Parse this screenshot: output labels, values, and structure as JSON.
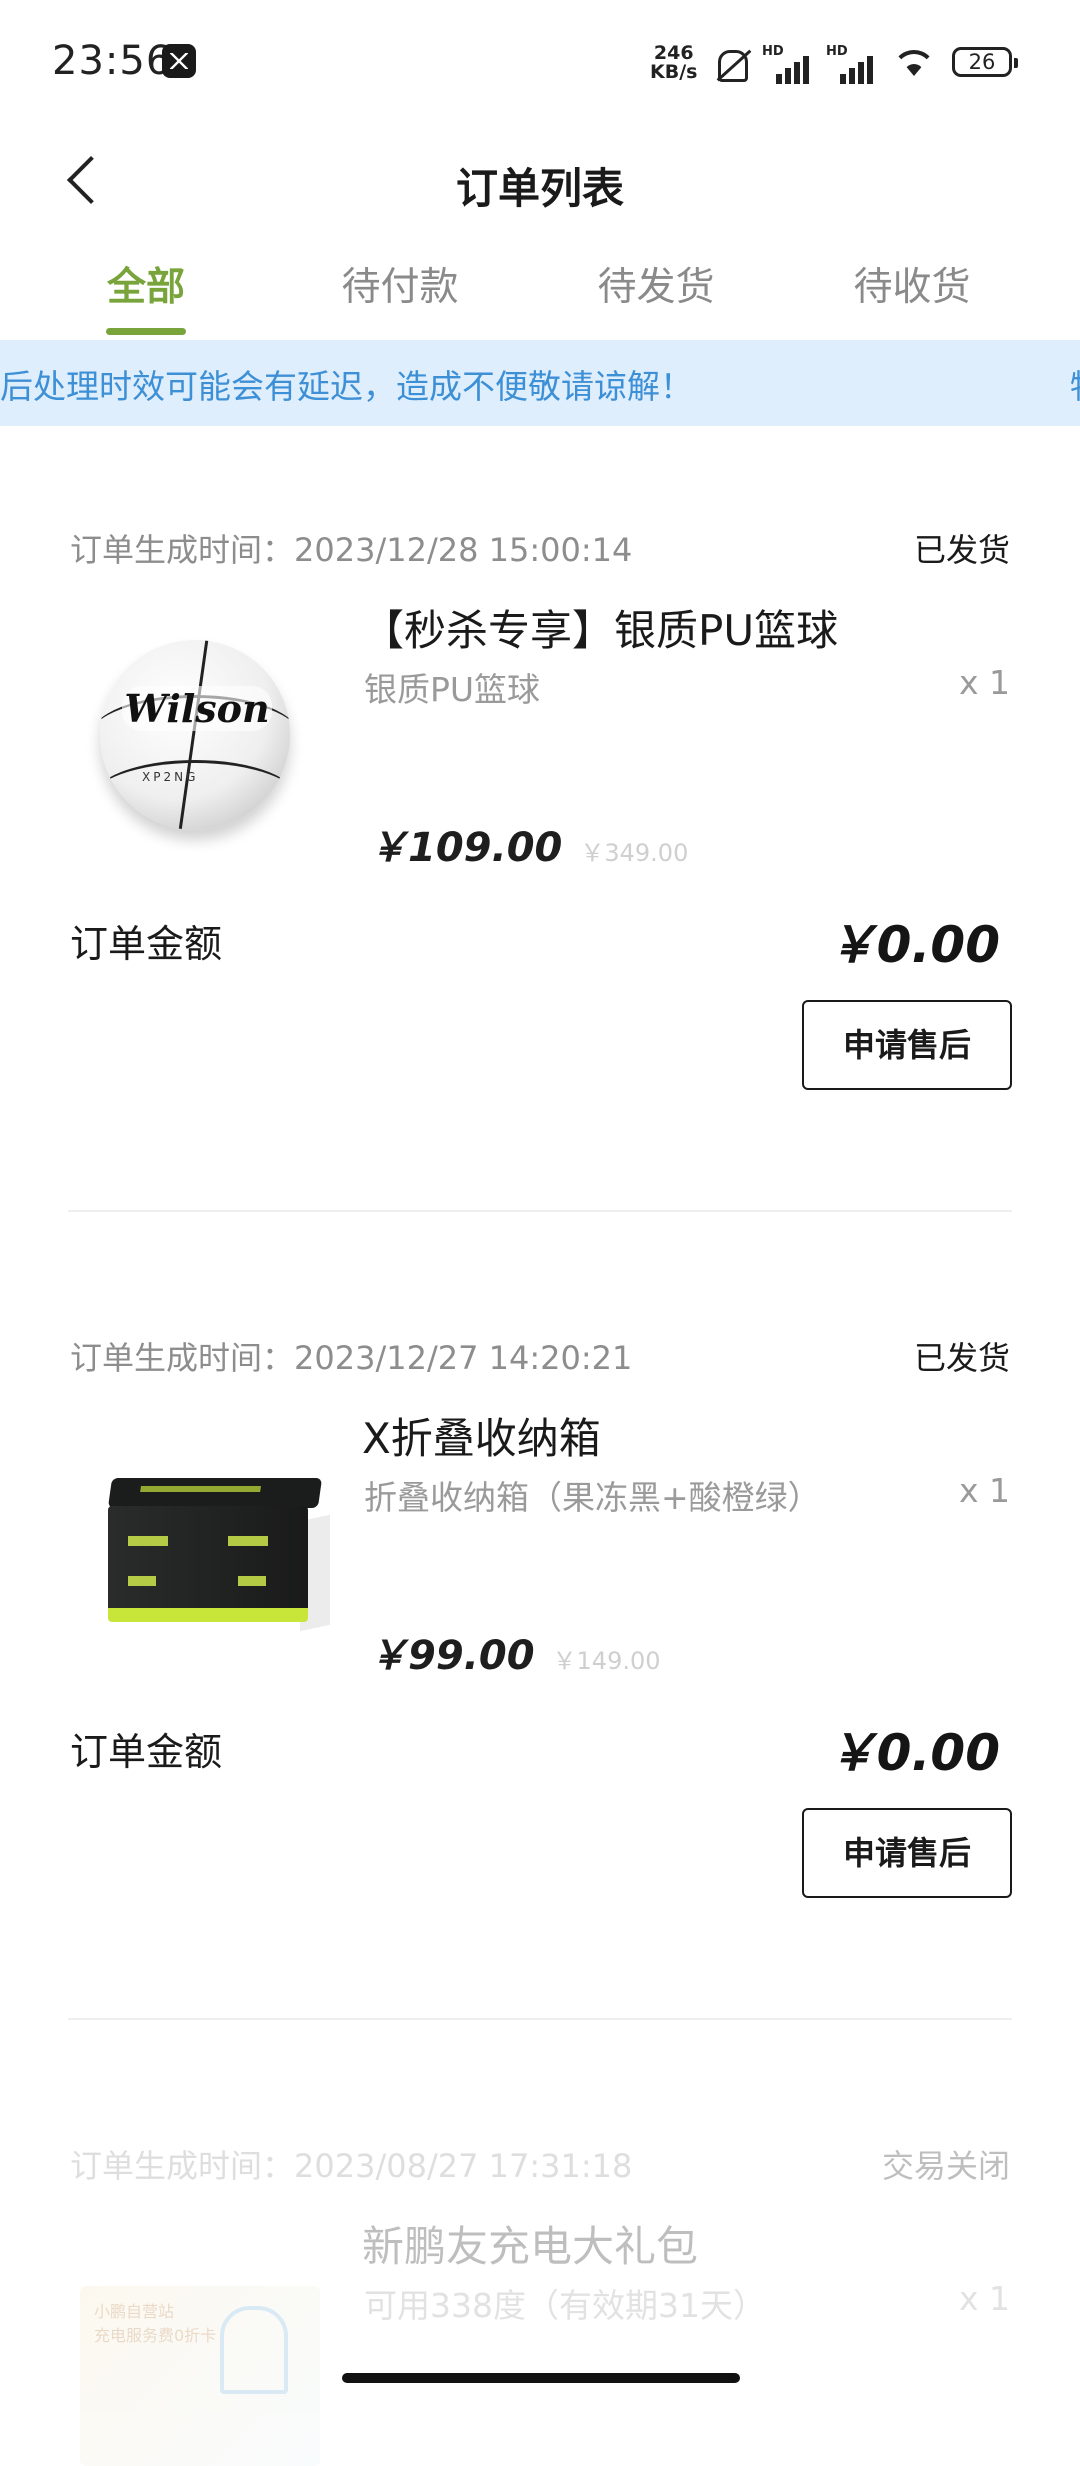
{
  "status_bar": {
    "time": "23:56",
    "net_speed_value": "246",
    "net_speed_unit": "KB/s",
    "hd1": "HD",
    "hd2": "HD",
    "battery": "26"
  },
  "header": {
    "title": "订单列表"
  },
  "tabs": [
    {
      "label": "全部",
      "active": true
    },
    {
      "label": "待付款",
      "active": false
    },
    {
      "label": "待发货",
      "active": false
    },
    {
      "label": "待收货",
      "active": false
    }
  ],
  "notice": {
    "text": "后处理时效可能会有延迟，造成不便敬请谅解！",
    "tail": "物"
  },
  "orders": [
    {
      "time_label": "订单生成时间：",
      "time": "2023/12/28 15:00:14",
      "status": "已发货",
      "image_icon": "basketball",
      "image_brand": "Wilson",
      "image_tag": "XP2NG",
      "name": "【秒杀专享】银质PU篮球",
      "spec": "银质PU篮球",
      "qty": "x 1",
      "price": "￥109.00",
      "original_price": "￥349.00",
      "total_label": "订单金额",
      "total": "￥0.00",
      "button": "申请售后"
    },
    {
      "time_label": "订单生成时间：",
      "time": "2023/12/27 14:20:21",
      "status": "已发货",
      "image_icon": "storage-box",
      "name": "X折叠收纳箱",
      "spec": "折叠收纳箱（果冻黑+酸橙绿）",
      "qty": "x 1",
      "price": "￥99.00",
      "original_price": "￥149.00",
      "total_label": "订单金额",
      "total": "￥0.00",
      "button": "申请售后"
    },
    {
      "time_label": "订单生成时间：",
      "time": "2023/08/27 17:31:18",
      "status": "交易关闭",
      "image_icon": "charging-gift-card",
      "image_text_1": "小鹏自营站",
      "image_text_2": "充电服务费0折卡",
      "name": "新鹏友充电大礼包",
      "spec": "可用338度（有效期31天）",
      "qty": "x 1"
    }
  ],
  "colors": {
    "accent_green": "#78a43b",
    "notice_bg": "#deeefc",
    "notice_text": "#3d8fd6"
  }
}
